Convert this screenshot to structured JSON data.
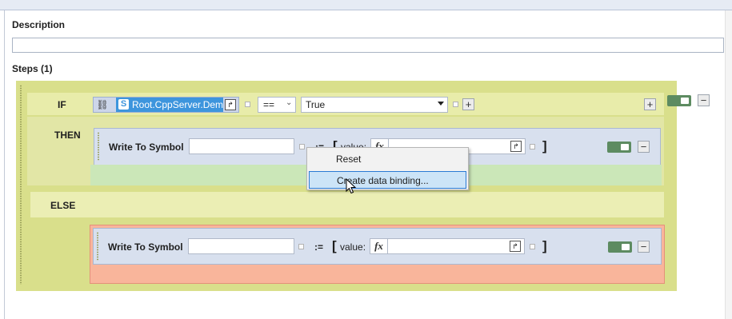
{
  "description": {
    "label": "Description",
    "value": ""
  },
  "steps": {
    "label": "Steps (1)"
  },
  "condition": {
    "if_label": "IF",
    "symbol": "Root.CppServer.Demo",
    "operator": "==",
    "value": "True"
  },
  "then_block": {
    "label": "THEN",
    "step_label": "Write To Symbol",
    "target": "",
    "assign_op": ":=",
    "open_bracket": "[",
    "close_bracket": "]",
    "value_label": "value:",
    "fx": "fx",
    "value": ""
  },
  "else_block": {
    "label": "ELSE",
    "step_label": "Write To Symbol",
    "target": "",
    "assign_op": ":=",
    "open_bracket": "[",
    "close_bracket": "]",
    "value_label": "value:",
    "fx": "fx",
    "value": ""
  },
  "context_menu": {
    "items": [
      "Reset",
      "Create data binding..."
    ],
    "highlighted": "Create data binding..."
  },
  "buttons": {
    "add": "+",
    "remove": "−"
  },
  "colors": {
    "step_area": "#d9df8b",
    "else_area": "#f9b59b",
    "step_box": "#d8e0ee",
    "toggle": "#5d8b61",
    "selection": "#3d95dd"
  }
}
